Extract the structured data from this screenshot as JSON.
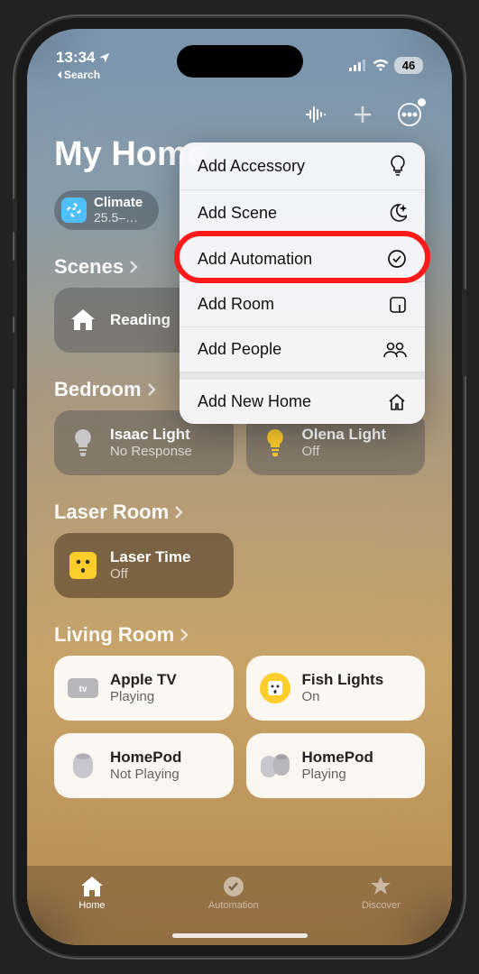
{
  "status": {
    "time": "13:34",
    "back_label": "Search",
    "battery": "46"
  },
  "home_title": "My Home",
  "climate": {
    "label": "Climate",
    "detail": "25.5–…"
  },
  "sections": {
    "scenes": "Scenes",
    "bedroom": "Bedroom",
    "laser": "Laser Room",
    "living": "Living Room"
  },
  "tiles": {
    "reading": {
      "title": "Reading"
    },
    "isaac": {
      "title": "Isaac Light",
      "sub": "No Response"
    },
    "olena": {
      "title": "Olena Light",
      "sub": "Off"
    },
    "laser_time": {
      "title": "Laser Time",
      "sub": "Off"
    },
    "apple_tv": {
      "title": "Apple TV",
      "sub": "Playing"
    },
    "fish": {
      "title": "Fish Lights",
      "sub": "On"
    },
    "homepod1": {
      "title": "HomePod",
      "sub": "Not Playing"
    },
    "homepod2": {
      "title": "HomePod",
      "sub": "Playing"
    }
  },
  "popover": {
    "add_accessory": "Add Accessory",
    "add_scene": "Add Scene",
    "add_automation": "Add Automation",
    "add_room": "Add Room",
    "add_people": "Add People",
    "add_new_home": "Add New Home"
  },
  "tabs": {
    "home": "Home",
    "automation": "Automation",
    "discover": "Discover"
  },
  "accent_red": "#ff1a1a"
}
